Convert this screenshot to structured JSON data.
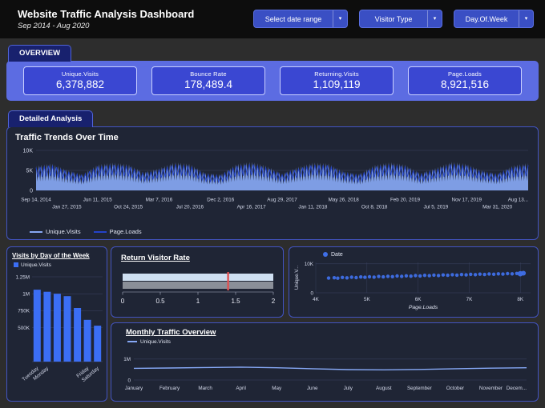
{
  "icons": {
    "chevron_down": "▾"
  },
  "theme": {
    "accent_blue": "#3a4fc4",
    "kpi_bar": "#5c6ce2",
    "panel_border": "#4254c2"
  },
  "header": {
    "title": "Website Traffic Analysis Dashboard",
    "subtitle": "Sep 2014 - Aug 2020",
    "filters": [
      {
        "label": "Select date range"
      },
      {
        "label": "Visitor Type"
      },
      {
        "label": "Day.Of.Week"
      }
    ]
  },
  "overview": {
    "tab": "OVERVIEW",
    "kpis": [
      {
        "label": "Unique.Visits",
        "value": "6,378,882"
      },
      {
        "label": "Bounce Rate",
        "value": "178,489.4"
      },
      {
        "label": "Returning.Visits",
        "value": "1,109,119"
      },
      {
        "label": "Page.Loads",
        "value": "8,921,516"
      }
    ]
  },
  "detailed": {
    "tab": "Detailed Analysis"
  },
  "chart_data": [
    {
      "type": "area",
      "title": "Traffic Trends Over Time",
      "x_ticks": [
        "Sep 14, 2014",
        "Jan 27, 2015",
        "Jun 11, 2015",
        "Oct 24, 2015",
        "Mar 7, 2016",
        "Jul 20, 2016",
        "Dec 2, 2016",
        "Apr 16, 2017",
        "Aug 29, 2017",
        "Jan 11, 2018",
        "May 26, 2018",
        "Oct 8, 2018",
        "Feb 20, 2019",
        "Jul 5, 2019",
        "Nov 17, 2019",
        "Mar 31, 2020",
        "Aug 13..."
      ],
      "y_ticks": [
        {
          "label": "0",
          "value": 0
        },
        {
          "label": "5K",
          "value": 5000
        },
        {
          "label": "10K",
          "value": 10000
        }
      ],
      "ylim": [
        0,
        10000
      ],
      "series": [
        {
          "name": "Unique.Visits",
          "color": "#87a7f3",
          "hi": [
            6200,
            6800,
            5200,
            4000,
            6500,
            7000,
            6600,
            4600,
            5600,
            7100,
            6700,
            4400,
            4000,
            6600,
            7200,
            6200,
            4200,
            5900,
            7000,
            6800,
            4800,
            4100,
            6400,
            7100,
            6500,
            4300,
            5700,
            7200,
            6700,
            5000,
            4200,
            6300,
            6900
          ],
          "lo": [
            2200,
            2400,
            1800,
            1400,
            2300,
            2500,
            2300,
            1600,
            2000,
            2500,
            2400,
            1500,
            1400,
            2300,
            2500,
            2200,
            1500,
            2100,
            2500,
            2400,
            1700,
            1400,
            2200,
            2500,
            2300,
            1500,
            2000,
            2500,
            2400,
            1800,
            1500,
            2200,
            2400
          ]
        },
        {
          "name": "Page.Loads",
          "color": "#2443c9",
          "hi": [
            5700,
            6300,
            4800,
            3700,
            6000,
            6400,
            6100,
            4200,
            5200,
            6500,
            6200,
            4000,
            3700,
            6100,
            6600,
            5700,
            3900,
            5400,
            6400,
            6300,
            4400,
            3800,
            5900,
            6500,
            6000,
            4000,
            5200,
            6600,
            6200,
            4600,
            3900,
            5800,
            6300
          ],
          "lo": [
            3300,
            3600,
            2700,
            2100,
            3500,
            3800,
            3500,
            2400,
            3000,
            3800,
            3600,
            2300,
            2100,
            3500,
            3800,
            3300,
            2300,
            3200,
            3800,
            3600,
            2600,
            2100,
            3300,
            3800,
            3500,
            2300,
            3000,
            3800,
            3600,
            2700,
            2300,
            3300,
            3600
          ]
        }
      ]
    },
    {
      "type": "bar",
      "title": "Visits by Day of the Week",
      "legend": "Unique.Visits",
      "x_labels": [
        "Tuesday",
        "Monday",
        "",
        "",
        "",
        "Friday",
        "Saturday"
      ],
      "values": [
        1060000,
        1030000,
        1000000,
        965000,
        790000,
        615000,
        530000
      ],
      "y_ticks": [
        {
          "label": "1.25M",
          "value": 1250000
        },
        {
          "label": "1M",
          "value": 1000000
        },
        {
          "label": "750K",
          "value": 750000
        },
        {
          "label": "500K",
          "value": 500000
        }
      ],
      "ylim": [
        0,
        1250000
      ],
      "bar_color": "#3b6ef5"
    },
    {
      "type": "bullet",
      "title": "Return Visitor Rate",
      "range": [
        0,
        2
      ],
      "ticks": [
        {
          "label": "0",
          "value": 0
        },
        {
          "label": "0.5",
          "value": 0.5
        },
        {
          "label": "1",
          "value": 1
        },
        {
          "label": "1.5",
          "value": 1.5
        },
        {
          "label": "2",
          "value": 2
        }
      ],
      "value": 2,
      "comparison": 2,
      "target": 1.4,
      "value_color": "#cfe0f2",
      "comparison_color": "#8a8f98",
      "target_color": "#e05252"
    },
    {
      "type": "scatter",
      "legend": "Date",
      "x_label": "Page.Loads",
      "y_label": "Unique.V...",
      "x_ticks": [
        {
          "label": "4K",
          "value": 4000
        },
        {
          "label": "5K",
          "value": 5000
        },
        {
          "label": "6K",
          "value": 6000
        },
        {
          "label": "7K",
          "value": 7000
        },
        {
          "label": "8K",
          "value": 8000
        }
      ],
      "y_ticks": [
        {
          "label": "10K",
          "value": 10000
        },
        {
          "label": "0",
          "value": 0
        }
      ],
      "xlim": [
        4000,
        8200
      ],
      "ylim": [
        0,
        10500
      ],
      "point_color": "#3f6fe8",
      "points": [
        [
          4250,
          5080
        ],
        [
          4360,
          5190
        ],
        [
          4430,
          5060
        ],
        [
          4520,
          5310
        ],
        [
          4610,
          5180
        ],
        [
          4700,
          5400
        ],
        [
          4790,
          5260
        ],
        [
          4880,
          5480
        ],
        [
          4960,
          5350
        ],
        [
          5050,
          5530
        ],
        [
          5140,
          5420
        ],
        [
          5230,
          5630
        ],
        [
          5320,
          5500
        ],
        [
          5410,
          5700
        ],
        [
          5500,
          5580
        ],
        [
          5590,
          5800
        ],
        [
          5680,
          5660
        ],
        [
          5770,
          5870
        ],
        [
          5860,
          5740
        ],
        [
          5950,
          5950
        ],
        [
          6040,
          5830
        ],
        [
          6130,
          6030
        ],
        [
          6220,
          5900
        ],
        [
          6310,
          6100
        ],
        [
          6400,
          5980
        ],
        [
          6490,
          6170
        ],
        [
          6580,
          6050
        ],
        [
          6670,
          6240
        ],
        [
          6760,
          6120
        ],
        [
          6850,
          6300
        ],
        [
          6940,
          6200
        ],
        [
          7030,
          6380
        ],
        [
          7120,
          6260
        ],
        [
          7210,
          6440
        ],
        [
          7300,
          6330
        ],
        [
          7390,
          6500
        ],
        [
          7480,
          6400
        ],
        [
          7570,
          6560
        ],
        [
          7660,
          6470
        ],
        [
          7750,
          6620
        ],
        [
          7840,
          6540
        ],
        [
          7930,
          6680
        ],
        [
          8000,
          6600,
          3.4
        ],
        [
          8060,
          6760,
          3
        ]
      ]
    },
    {
      "type": "line",
      "title": "Monthly Traffic Overview",
      "legend": "Unique.Visits",
      "x_labels": [
        "January",
        "February",
        "March",
        "April",
        "May",
        "June",
        "July",
        "August",
        "September",
        "October",
        "November",
        "Decem..."
      ],
      "values": [
        560000,
        575000,
        595000,
        615000,
        585000,
        540000,
        498000,
        485000,
        505000,
        540000,
        565000,
        585000
      ],
      "y_ticks": [
        {
          "label": "1M",
          "value": 1000000
        },
        {
          "label": "0",
          "value": 0
        }
      ],
      "ylim": [
        0,
        1300000
      ],
      "line_color": "#86a8f5"
    }
  ]
}
